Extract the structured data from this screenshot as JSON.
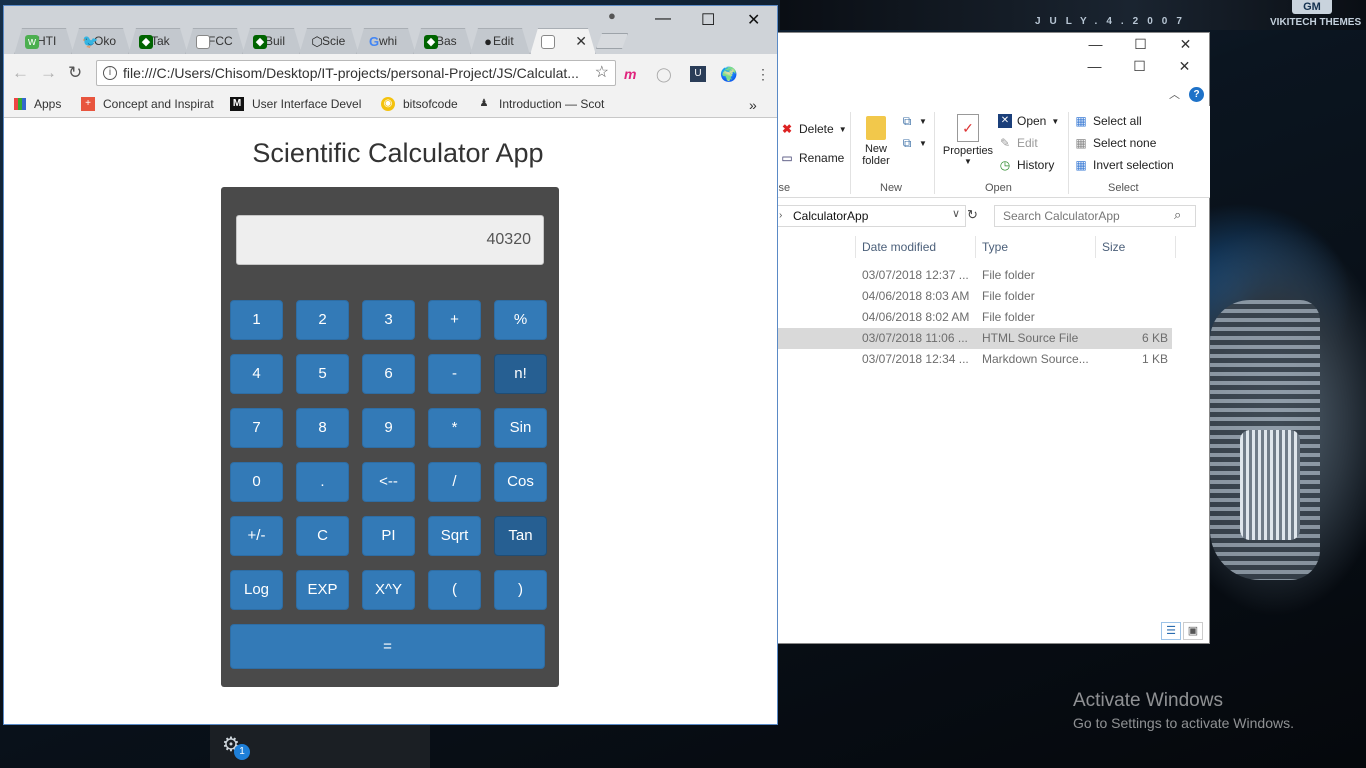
{
  "desktop": {
    "wallpaper_date": "JULY.4.2007",
    "wallpaper_brand": "GM",
    "wallpaper_theme": "VIKITECH THEMES",
    "activate_title": "Activate Windows",
    "activate_sub": "Go to Settings to activate Windows.",
    "tray_badge": "1"
  },
  "browser": {
    "tabs": [
      {
        "label": "HTI",
        "icon": "w3-icon",
        "color": "#4caf50"
      },
      {
        "label": "Oko",
        "icon": "twitter-icon",
        "color": "#1da1f2"
      },
      {
        "label": "Tak",
        "icon": "freecodecamp-icon",
        "color": "#006400"
      },
      {
        "label": "FCC",
        "icon": "page-icon",
        "color": "#888888"
      },
      {
        "label": "Buil",
        "icon": "freecodecamp-icon",
        "color": "#006400"
      },
      {
        "label": "Scie",
        "icon": "codepen-icon",
        "color": "#222222"
      },
      {
        "label": "whi",
        "icon": "google-icon",
        "color": "#4285f4"
      },
      {
        "label": "Bas",
        "icon": "freecodecamp-icon",
        "color": "#006400"
      },
      {
        "label": "Edit",
        "icon": "github-icon",
        "color": "#222222"
      },
      {
        "label": "",
        "icon": "page-icon",
        "color": "#888888"
      }
    ],
    "url": "file:///C:/Users/Chisom/Desktop/IT-projects/personal-Project/JS/Calculat...",
    "bookmarks": [
      {
        "label": "Apps"
      },
      {
        "label": "Concept and Inspirat"
      },
      {
        "label": "User Interface Devel"
      },
      {
        "label": "bitsofcode"
      },
      {
        "label": "Introduction — Scot"
      }
    ],
    "bookmarks_overflow": "»"
  },
  "calculator": {
    "title": "Scientific Calculator App",
    "display_value": "40320",
    "keys": [
      [
        "1",
        "2",
        "3",
        "+",
        "%"
      ],
      [
        "4",
        "5",
        "6",
        "-",
        "n!"
      ],
      [
        "7",
        "8",
        "9",
        "*",
        "Sin"
      ],
      [
        "0",
        ".",
        "<--",
        "/",
        "Cos"
      ],
      [
        "+/-",
        "C",
        "PI",
        "Sqrt",
        "Tan"
      ],
      [
        "Log",
        "EXP",
        "X^Y",
        "(",
        ")"
      ]
    ],
    "equals_label": "=",
    "highlighted": [
      "n!",
      "Tan"
    ]
  },
  "explorer": {
    "ribbon": {
      "delete_label": "Delete",
      "rename_label": "Rename",
      "organize_label": "ise",
      "new_folder_label_1": "New",
      "new_folder_label_2": "folder",
      "new_label": "New",
      "properties_label": "Properties",
      "open_label": "Open",
      "edit_label": "Edit",
      "history_label": "History",
      "open_group_label": "Open",
      "select_all_label": "Select all",
      "select_none_label": "Select none",
      "invert_selection_label": "Invert selection",
      "select_group_label": "Select"
    },
    "address": "CalculatorApp",
    "search_placeholder": "Search CalculatorApp",
    "columns": {
      "date": "Date modified",
      "type": "Type",
      "size": "Size"
    },
    "files": [
      {
        "date": "03/07/2018 12:37 ...",
        "type": "File folder",
        "size": "",
        "selected": false
      },
      {
        "date": "04/06/2018 8:03 AM",
        "type": "File folder",
        "size": "",
        "selected": false
      },
      {
        "date": "04/06/2018 8:02 AM",
        "type": "File folder",
        "size": "",
        "selected": false
      },
      {
        "date": "03/07/2018 11:06 ...",
        "type": "HTML Source File",
        "size": "6 KB",
        "selected": true
      },
      {
        "date": "03/07/2018 12:34 ...",
        "type": "Markdown Source...",
        "size": "1 KB",
        "selected": false
      }
    ]
  }
}
